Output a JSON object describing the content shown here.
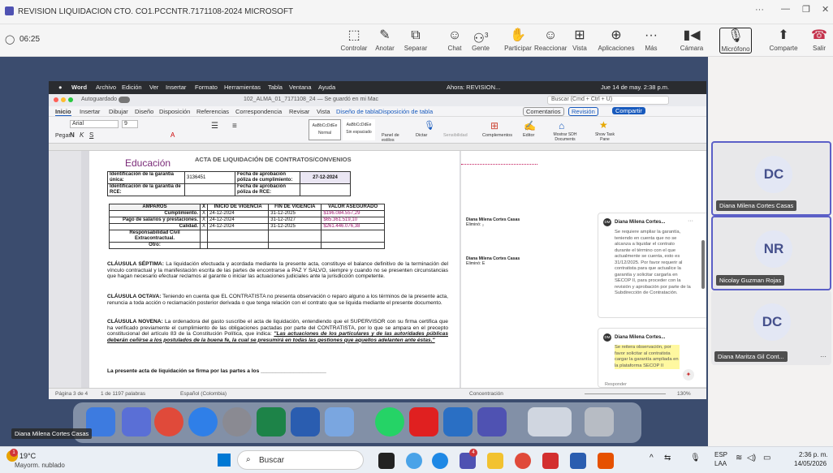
{
  "window": {
    "title": "REVISION LIQUIDACION CTO. CO1.PCCNTR.7171108-2024 MICROSOFT",
    "timer": "06:25"
  },
  "teams": {
    "controls": [
      "Controlar",
      "Anotar",
      "Separar",
      "Chat",
      "Gente",
      "Participar",
      "Reaccionar",
      "Vista",
      "Aplicaciones",
      "Más",
      "Cámara",
      "Micrófono",
      "Comparte",
      "Salir"
    ],
    "people_count": "3"
  },
  "mac": {
    "menu": [
      "Word",
      "Archivo",
      "Edición",
      "Ver",
      "Insertar",
      "Formato",
      "Herramientas",
      "Tabla",
      "Ventana",
      "Ayuda"
    ],
    "status": "Ahora: REVISION...",
    "date": "Jue 14 de may. 2:38 p.m."
  },
  "word": {
    "autosave": "Autoguardado",
    "doc_title": "102_ALMA_01_7171108_24 — Se guardó en mi Mac",
    "search": "Buscar (Cmd + Ctrl + U)",
    "tabs": [
      "Inicio",
      "Insertar",
      "Dibujar",
      "Diseño",
      "Disposición",
      "Referencias",
      "Correspondencia",
      "Revisar",
      "Vista",
      "Diseño de tabla",
      "Disposición de tabla"
    ],
    "comentarios": "Comentarios",
    "revision": "Revisión",
    "compartir": "Compartir",
    "font": "Arial",
    "size": "9",
    "paste": "Pegar",
    "styles": [
      "Normal",
      "Sin espaciado"
    ],
    "style_sample": "AaBbCcDdEe",
    "ribbon_btns": [
      "Panel de estilos",
      "Dictar",
      "Sensibilidad",
      "Complementos",
      "Editor",
      "Mostrar SDH Documents",
      "Show Task Pane"
    ],
    "status": {
      "page": "Página 3 de 4",
      "words": "1 de 1197 palabras",
      "lang": "Español (Colombia)",
      "focus": "Concentración",
      "zoom": "130%"
    }
  },
  "doc": {
    "logo": "Educación",
    "heading": "ACTA DE LIQUIDACIÓN DE CONTRATOS/CONVENIOS",
    "guarantee": {
      "id_label": "Identificación de la garantía única:",
      "id_value": "3136451",
      "approval_label": "Fecha de aprobación póliza de cumplimiento:",
      "approval_value": "27-12-2024",
      "rce_label": "Identificación de la garantía de RCE:",
      "rce_approval_label": "Fecha de aprobación póliza de RCE:"
    },
    "amparos": {
      "headers": [
        "AMPAROS",
        "X",
        "INICIO DE VIGENCIA",
        "FIN DE VIGENCIA",
        "VALOR ASEGURADO"
      ],
      "rows": [
        [
          "Cumplimiento.",
          "X",
          "24-12-2024",
          "31-12-2025",
          "$196.084.557,29"
        ],
        [
          "Pago de salarios y prestaciones.",
          "X",
          "24-12-2024",
          "31-12-2027",
          "$65.361.519,10"
        ],
        [
          "Calidad.",
          "X",
          "24-12-2024",
          "31-12-2025",
          "$261.446.076,38"
        ],
        [
          "Responsabilidad Civil Extracontractual.",
          "",
          "",
          "",
          ""
        ],
        [
          "Otro:",
          "",
          "",
          "",
          ""
        ]
      ]
    },
    "p7_title": "CLÁUSULA SÉPTIMA:",
    "p7": "La liquidación efectuada y acordada mediante la presente acta, constituye el balance definitivo de la terminación del vínculo contractual y la manifestación escrita de las partes de encontrarse a PAZ Y SALVO, siempre y cuando no se presenten circunstancias que hagan necesario efectuar reclamos al garante o iniciar las actuaciones judiciales ante la jurisdicción competente.",
    "p8_title": "CLÁUSULA OCTAVA:",
    "p8": "Teniendo en cuenta que EL CONTRATISTA no presenta observación o reparo alguno a los términos de la presente acta, renuncia a toda acción o reclamación posterior derivada o que tenga relación con el contrato que se liquida mediante el presente documento.",
    "p9_title": "CLÁUSULA NOVENA:",
    "p9": "La ordenadora del gasto suscribe el acta de liquidación, entendiendo que el SUPERVISOR con su firma certifica que ha verificado previamente el cumplimiento de las obligaciones pactadas por parte del CONTRATISTA, por lo que se ampara en el precepto constitucional del artículo 83 de la Constitución Política, que indica:",
    "p9_quote": "\"Las actuaciones de los particulares y de las autoridades públicas deberán ceñirse a los postulados de la buena fe, la cual se presumirá en todas las gestiones que aquellos adelanten ante éstas.\"",
    "sign": "La presente acta de liquidación se firma por las partes a los ______________________"
  },
  "margin": {
    "del1_author": "Diana Milena Cortes Casas",
    "del1": "Eliminó: ₂",
    "del2_author": "Diana Milena Cortes Casas",
    "del2": "Eliminó: E",
    "c1_author": "Diana Milena Cortes...",
    "c1_initials": "DM",
    "c1": "Se requiere ampliar la garantía, teniendo en cuenta que no se alcanza a liquidar el contrato durante el término con el que actualmente se cuenta, esto es 31/12/2025. Por favor requerir al contratista para que actualice la garantía y solicitar cargarla en SECOP II, para proceder con la revisión y aprobación por parte de la Subdirección de Contratación.",
    "c2_author": "Diana Milena Cortes...",
    "c2_initials": "DM",
    "c2": "Se reitera observación, por favor solicitar al contratista cargar la garantía ampliada en la plataforma SECOP II",
    "reply": "Responder"
  },
  "participants": [
    {
      "initials": "DC",
      "name": "Diana Milena Cortes Casas"
    },
    {
      "initials": "NR",
      "name": "Nicolay Guzman Rojas"
    },
    {
      "initials": "DC",
      "name": "Diana Maritza Gil Cont..."
    }
  ],
  "presenter_label": "Diana Milena Cortes Casas",
  "taskbar": {
    "temp": "19°C",
    "weather": "Mayorm. nublado",
    "search": "Buscar",
    "lang": "ESP",
    "lang2": "LAA",
    "time": "2:36 p. m.",
    "date": "14/05/2026",
    "badge_weather": "1",
    "badge_teams": "4"
  },
  "colors": {
    "accent": "#4f52b2",
    "leave": "#c4314b",
    "word_blue": "#185abd"
  }
}
